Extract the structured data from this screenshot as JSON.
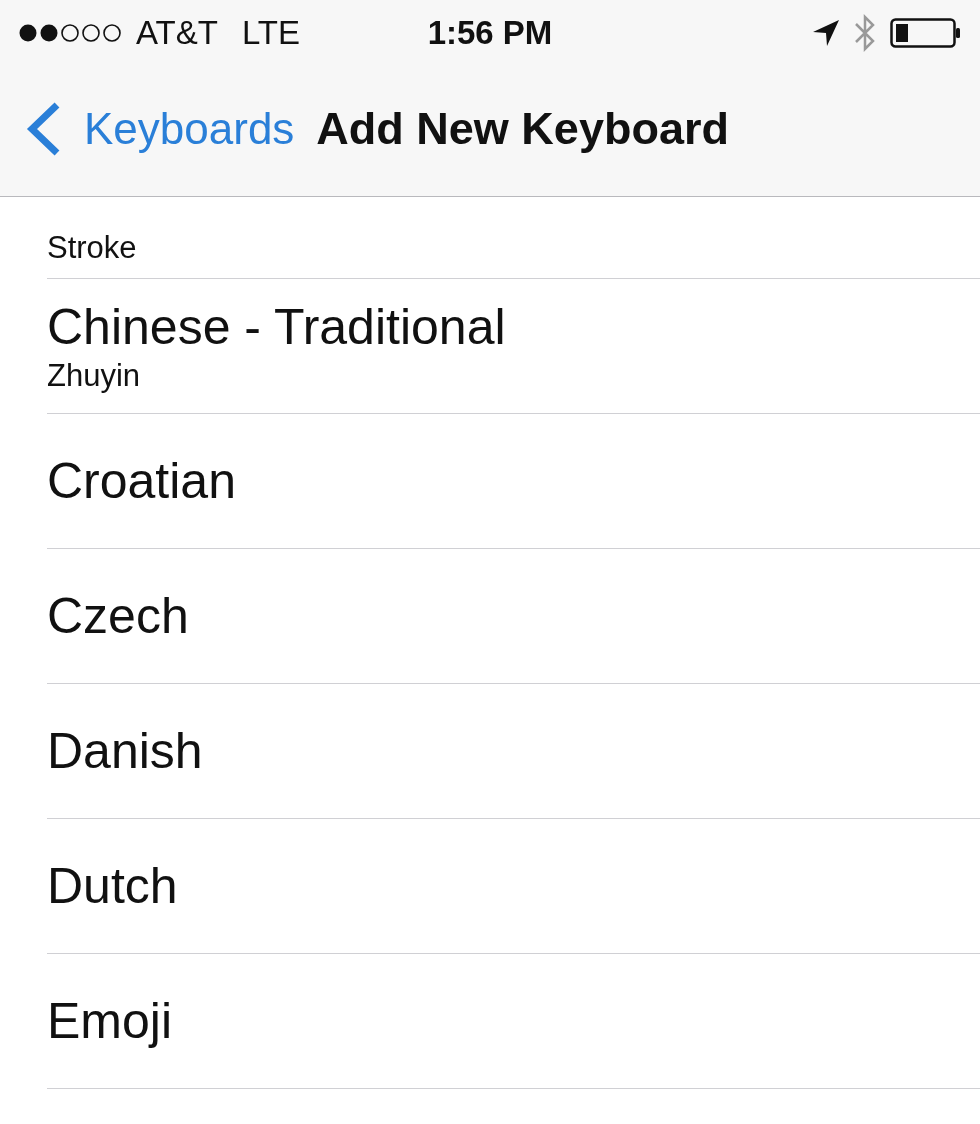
{
  "status_bar": {
    "carrier": "AT&T",
    "network": "LTE",
    "time": "1:56 PM"
  },
  "nav_bar": {
    "back": "Keyboards",
    "title": "Add New Keyboard"
  },
  "keyboards": [
    {
      "subtitle": "Stroke"
    },
    {
      "title": "Chinese - Traditional",
      "subtitle": "Zhuyin"
    },
    {
      "title": "Croatian"
    },
    {
      "title": "Czech"
    },
    {
      "title": "Danish"
    },
    {
      "title": "Dutch"
    },
    {
      "title": "Emoji"
    }
  ]
}
